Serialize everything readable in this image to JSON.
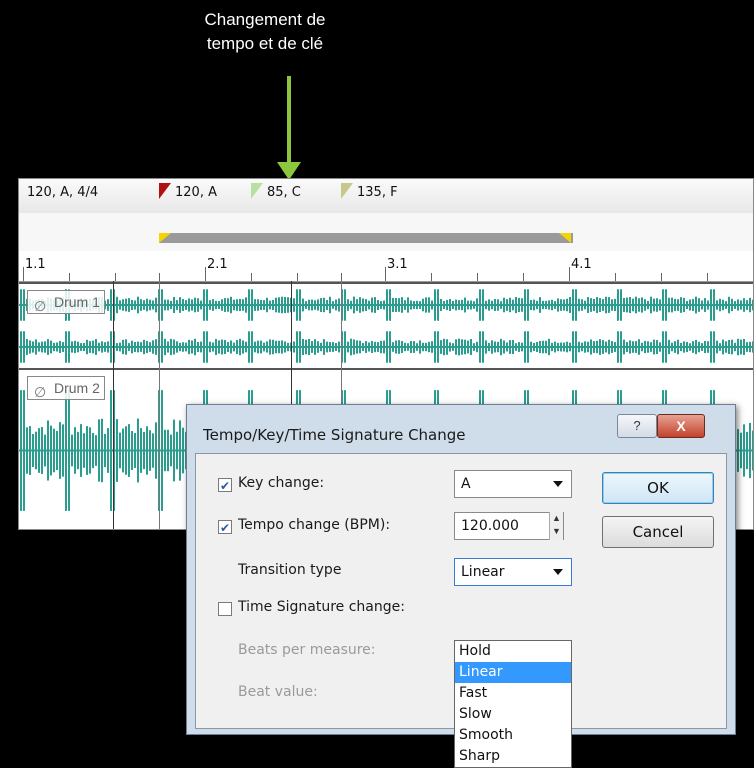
{
  "annotation": {
    "line1": "Changement de",
    "line2": "tempo et de clé",
    "arrow_color": "#8cc63f"
  },
  "timeline": {
    "markers": [
      {
        "label": "120, A, 4/4"
      },
      {
        "label": "120, A",
        "color": "#b01010"
      },
      {
        "label": "85, C",
        "color": "#b8e0a0"
      },
      {
        "label": "135, F",
        "color": "#c8c88a"
      }
    ],
    "ruler": [
      "1.1",
      "2.1",
      "3.1",
      "4.1"
    ],
    "tracks": [
      {
        "name": "Drum 1"
      },
      {
        "name": "Drum 2"
      }
    ],
    "waveform_color": "#2a9d8f"
  },
  "dialog": {
    "title": "Tempo/Key/Time Signature Change",
    "help_label": "?",
    "close_label": "X",
    "key_change": {
      "label": "Key change:",
      "checked": true,
      "value": "A"
    },
    "tempo_change": {
      "label": "Tempo change (BPM):",
      "checked": true,
      "value": "120.000"
    },
    "transition": {
      "label": "Transition type",
      "value": "Linear"
    },
    "time_sig": {
      "label": "Time Signature change:",
      "checked": false
    },
    "beats_per_measure": {
      "label": "Beats per measure:"
    },
    "beat_value": {
      "label": "Beat value:"
    },
    "ok_label": "OK",
    "cancel_label": "Cancel",
    "transition_options": [
      "Hold",
      "Linear",
      "Fast",
      "Slow",
      "Smooth",
      "Sharp"
    ],
    "transition_selected": "Linear"
  }
}
